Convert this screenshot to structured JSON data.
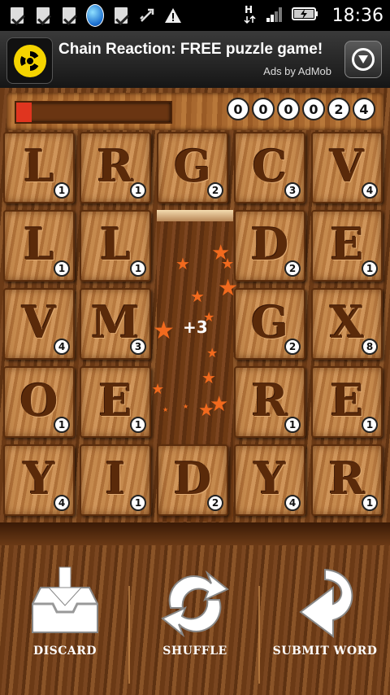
{
  "status_bar": {
    "icons": [
      "download-done-icon",
      "download-done-icon",
      "download-done-icon",
      "browser-globe-icon",
      "download-done-icon",
      "usb-debug-icon",
      "warning-icon",
      "hspa-icon",
      "signal-icon",
      "battery-charging-icon"
    ],
    "time": "18:36"
  },
  "ad": {
    "title": "Chain Reaction: FREE puzzle game!",
    "subtitle": "Ads by AdMob",
    "logo_icon": "radioactive-icon",
    "action_icon": "download-icon"
  },
  "game": {
    "progress_fraction": 0.1,
    "progress_color": "#e0351f",
    "score_digits": [
      "0",
      "0",
      "0",
      "0",
      "2",
      "4"
    ],
    "bonus": "+3",
    "tiles": [
      [
        {
          "letter": "L",
          "points": "1"
        },
        {
          "letter": "R",
          "points": "1"
        },
        {
          "letter": "G",
          "points": "2"
        },
        {
          "letter": "C",
          "points": "3"
        },
        {
          "letter": "V",
          "points": "4"
        }
      ],
      [
        {
          "letter": "L",
          "points": "1"
        },
        {
          "letter": "L",
          "points": "1"
        },
        null,
        {
          "letter": "D",
          "points": "2"
        },
        {
          "letter": "E",
          "points": "1"
        }
      ],
      [
        {
          "letter": "V",
          "points": "4"
        },
        {
          "letter": "M",
          "points": "3"
        },
        null,
        {
          "letter": "G",
          "points": "2"
        },
        {
          "letter": "X",
          "points": "8"
        }
      ],
      [
        {
          "letter": "O",
          "points": "1"
        },
        {
          "letter": "E",
          "points": "1"
        },
        null,
        {
          "letter": "R",
          "points": "1"
        },
        {
          "letter": "E",
          "points": "1"
        }
      ],
      [
        {
          "letter": "Y",
          "points": "4"
        },
        {
          "letter": "I",
          "points": "1"
        },
        {
          "letter": "D",
          "points": "2"
        },
        {
          "letter": "Y",
          "points": "4"
        },
        {
          "letter": "R",
          "points": "1"
        }
      ]
    ]
  },
  "actions": {
    "discard": "DISCARD",
    "shuffle": "SHUFFLE",
    "submit": "SUBMIT WORD"
  }
}
